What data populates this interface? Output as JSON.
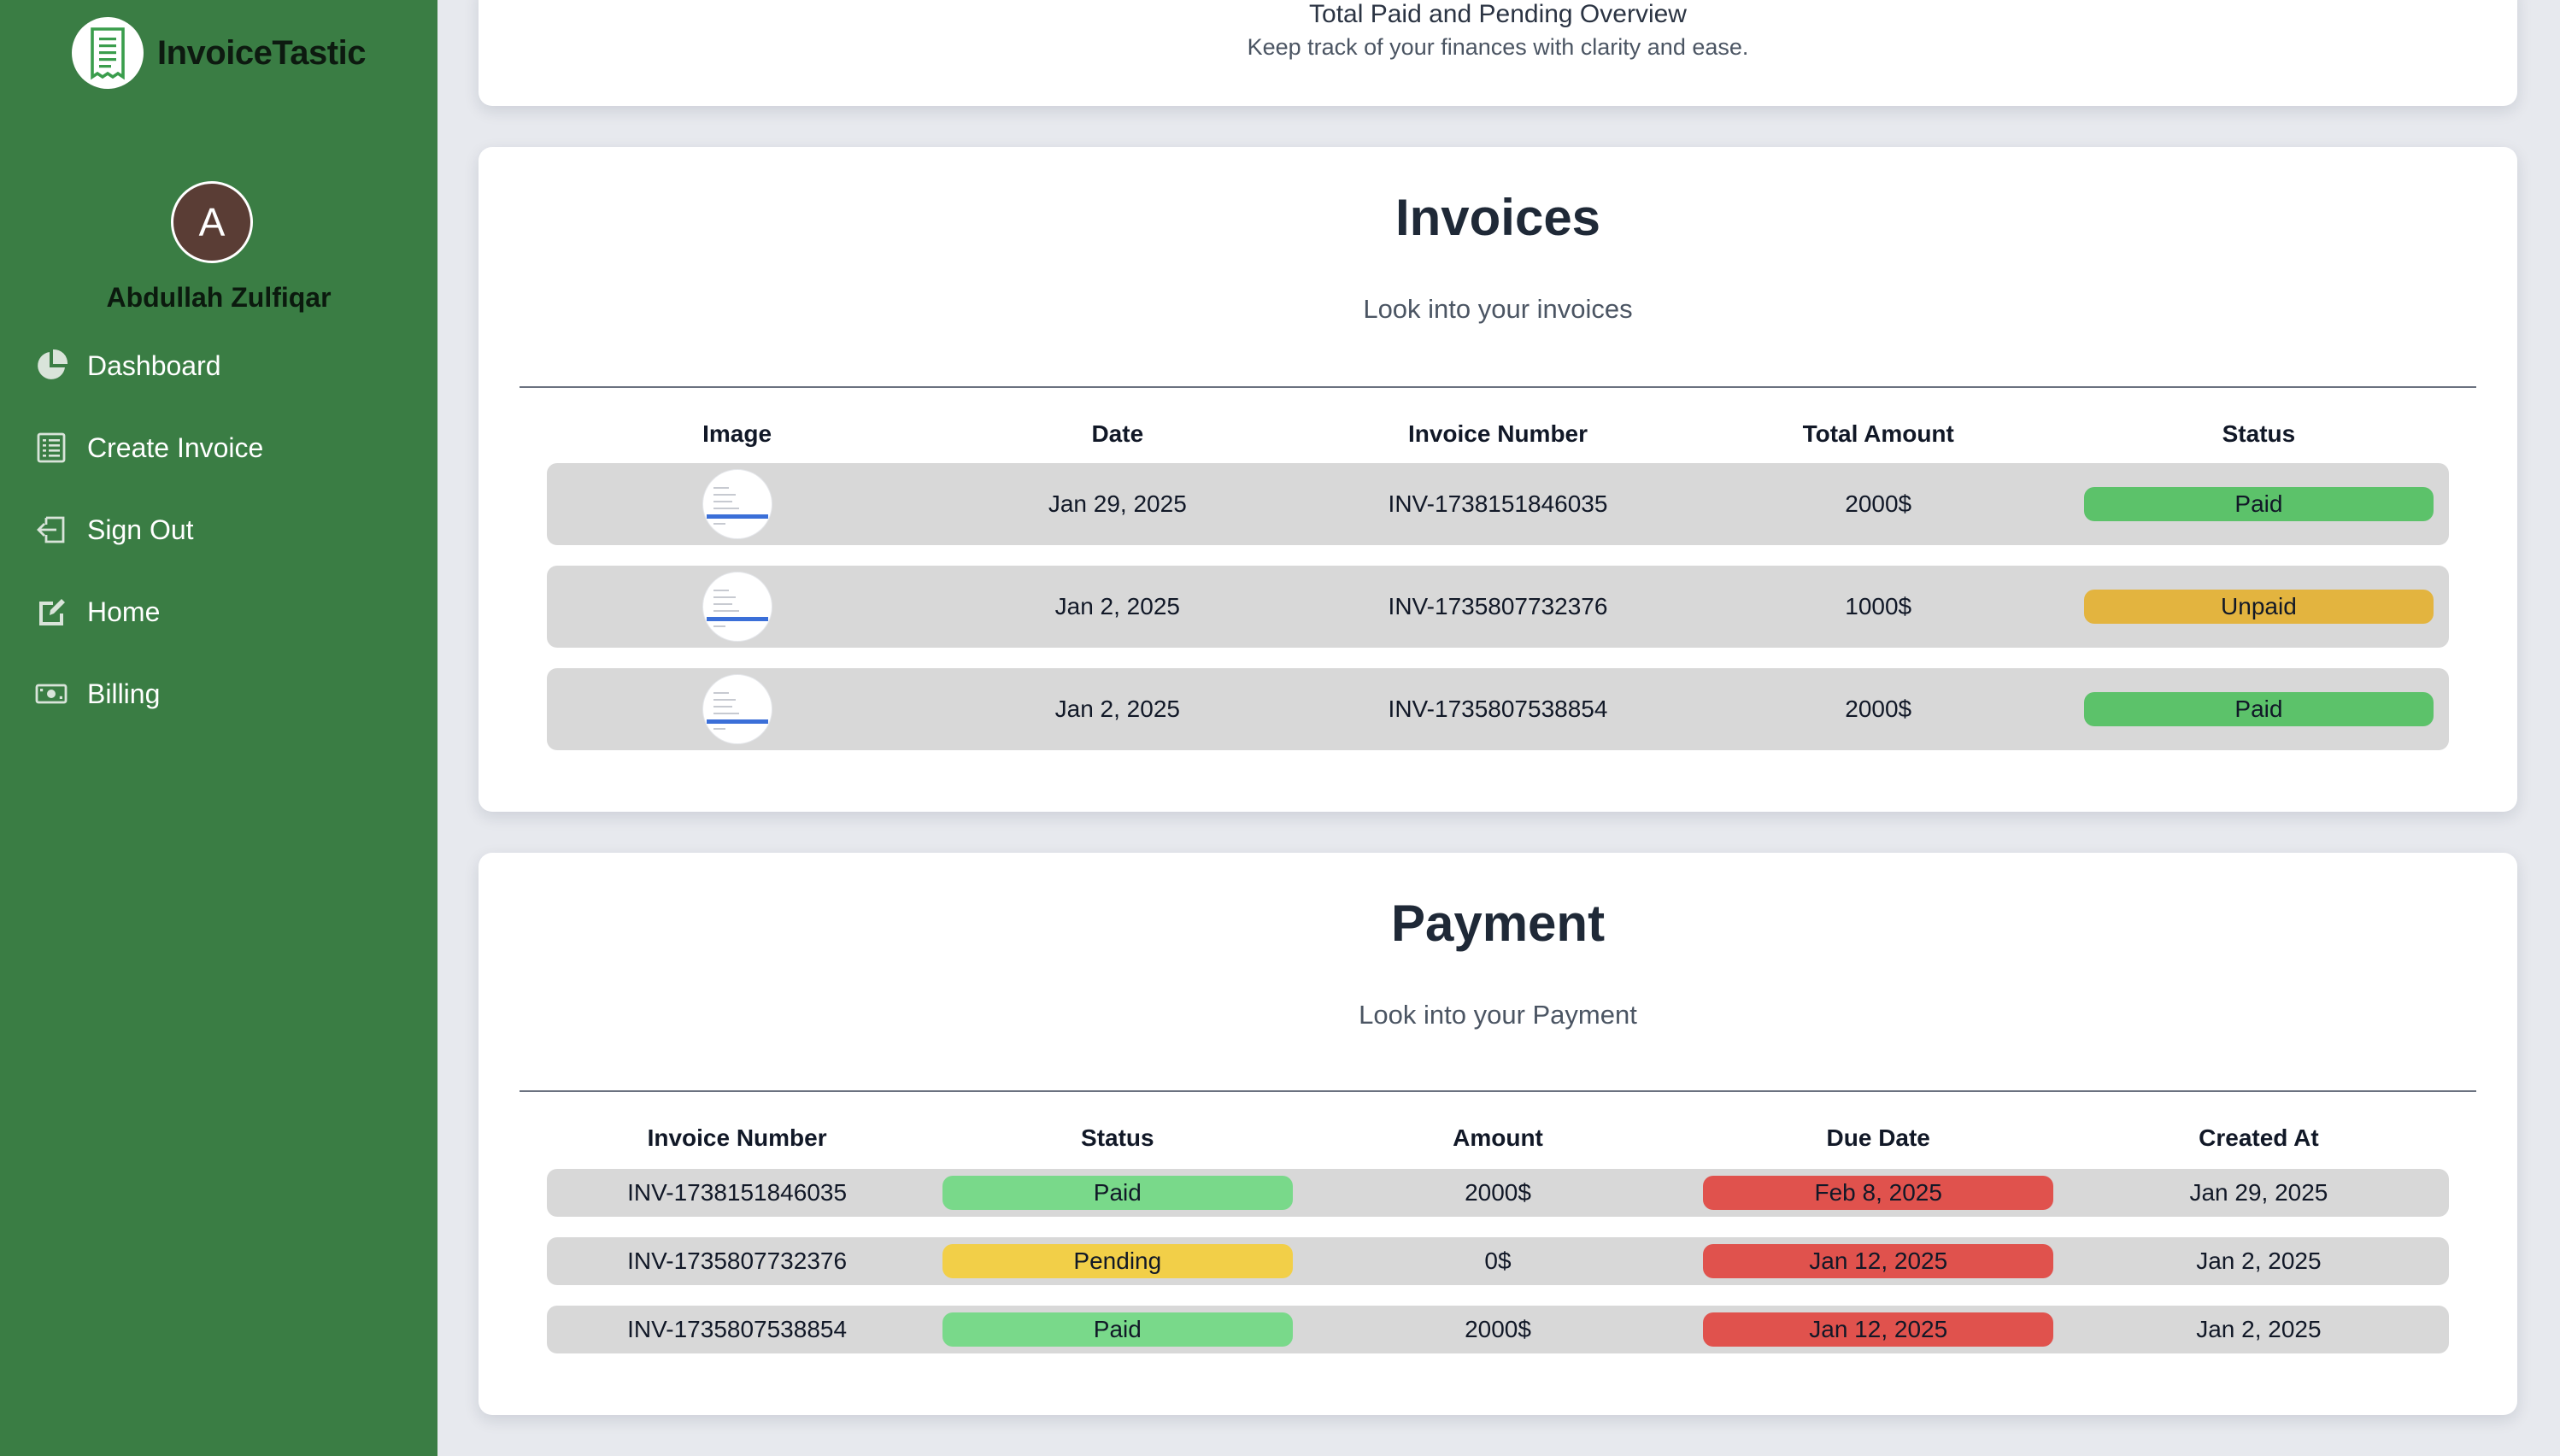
{
  "brand": {
    "name": "InvoiceTastic",
    "logo_icon": "receipt-icon"
  },
  "user": {
    "initial": "A",
    "name": "Abdullah Zulfiqar"
  },
  "nav": [
    {
      "label": "Dashboard",
      "icon": "pie-chart-icon"
    },
    {
      "label": "Create Invoice",
      "icon": "receipt-icon"
    },
    {
      "label": "Sign Out",
      "icon": "sign-out-icon"
    },
    {
      "label": "Home",
      "icon": "edit-icon"
    },
    {
      "label": "Billing",
      "icon": "cash-icon"
    }
  ],
  "overview": {
    "title": "Total Paid and Pending Overview",
    "subtitle": "Keep track of your finances with clarity and ease."
  },
  "invoices": {
    "title": "Invoices",
    "subtitle": "Look into your invoices",
    "columns": [
      "Image",
      "Date",
      "Invoice Number",
      "Total Amount",
      "Status"
    ],
    "rows": [
      {
        "date": "Jan 29, 2025",
        "number": "INV-1738151846035",
        "amount": "2000$",
        "status": "Paid",
        "status_color": "#5cc26a"
      },
      {
        "date": "Jan 2, 2025",
        "number": "INV-1735807732376",
        "amount": "1000$",
        "status": "Unpaid",
        "status_color": "#e3b43f"
      },
      {
        "date": "Jan 2, 2025",
        "number": "INV-1735807538854",
        "amount": "2000$",
        "status": "Paid",
        "status_color": "#5cc26a"
      }
    ]
  },
  "payment": {
    "title": "Payment",
    "subtitle": "Look into your Payment",
    "columns": [
      "Invoice Number",
      "Status",
      "Amount",
      "Due Date",
      "Created At"
    ],
    "rows": [
      {
        "number": "INV-1738151846035",
        "status": "Paid",
        "status_color": "#79d98a",
        "amount": "2000$",
        "due": "Feb 8, 2025",
        "due_color": "#e0524d",
        "created": "Jan 29, 2025"
      },
      {
        "number": "INV-1735807732376",
        "status": "Pending",
        "status_color": "#f2cf48",
        "amount": "0$",
        "due": "Jan 12, 2025",
        "due_color": "#e0524d",
        "created": "Jan 2, 2025"
      },
      {
        "number": "INV-1735807538854",
        "status": "Paid",
        "status_color": "#79d98a",
        "amount": "2000$",
        "due": "Jan 12, 2025",
        "due_color": "#e0524d",
        "created": "Jan 2, 2025"
      }
    ]
  },
  "colors": {
    "sidebar": "#3a7d44",
    "background": "#e7e9ee",
    "row": "#d8d8d8"
  }
}
